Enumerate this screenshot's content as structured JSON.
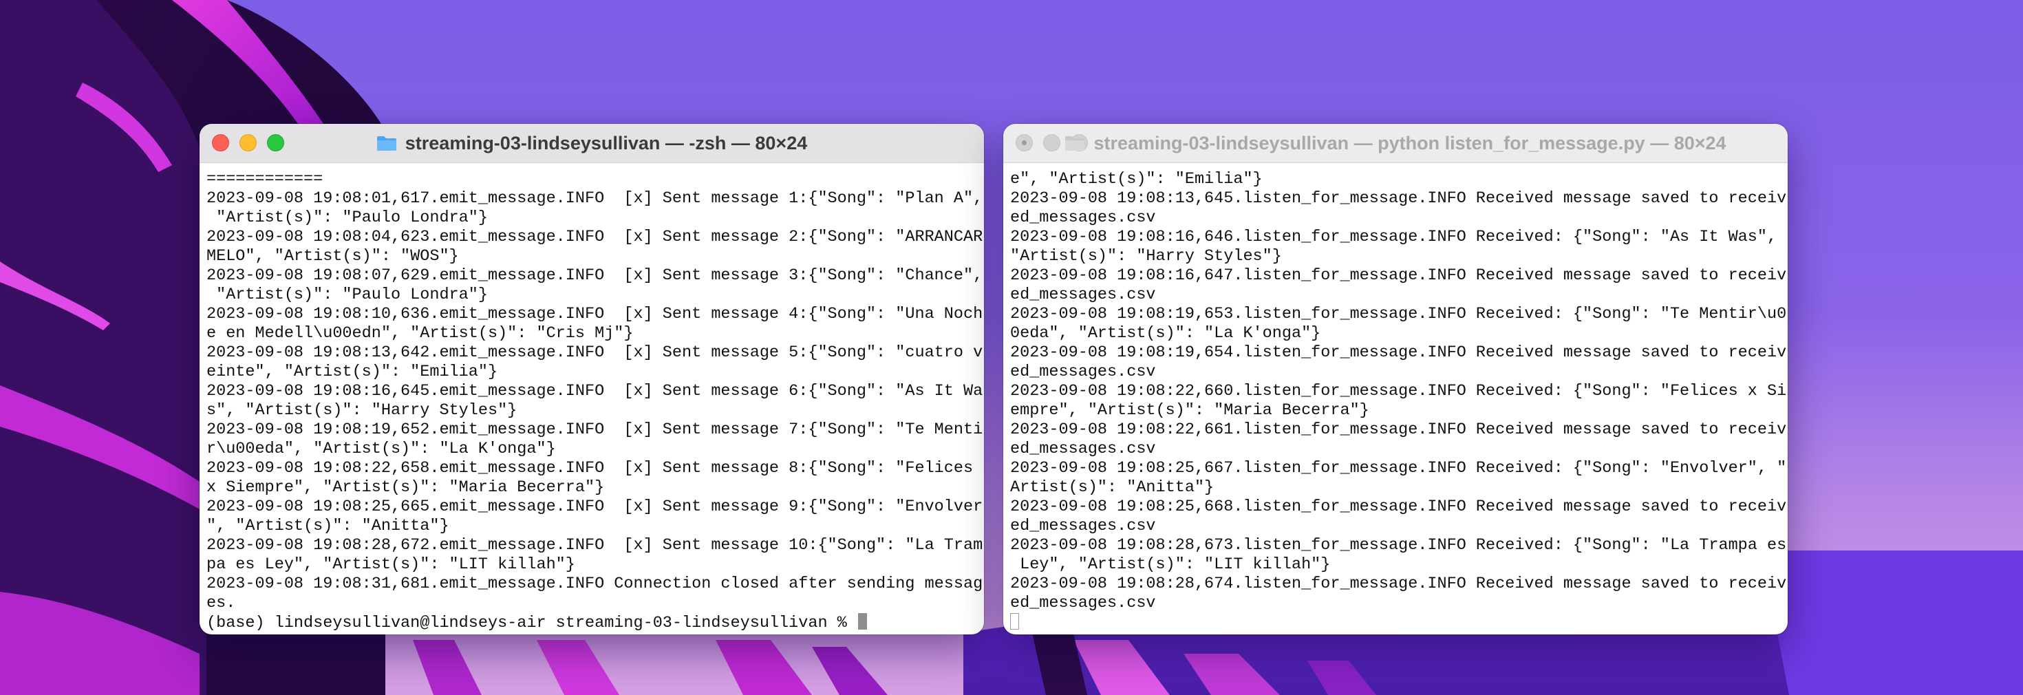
{
  "left_window": {
    "title": "streaming-03-lindseysullivan — -zsh — 80×24",
    "lines": [
      "============",
      "2023-09-08 19:08:01,617.emit_message.INFO  [x] Sent message 1:{\"Song\": \"Plan A\",",
      " \"Artist(s)\": \"Paulo Londra\"}",
      "2023-09-08 19:08:04,623.emit_message.INFO  [x] Sent message 2:{\"Song\": \"ARRANCAR",
      "MELO\", \"Artist(s)\": \"WOS\"}",
      "2023-09-08 19:08:07,629.emit_message.INFO  [x] Sent message 3:{\"Song\": \"Chance\",",
      " \"Artist(s)\": \"Paulo Londra\"}",
      "2023-09-08 19:08:10,636.emit_message.INFO  [x] Sent message 4:{\"Song\": \"Una Noch",
      "e en Medell\\u00edn\", \"Artist(s)\": \"Cris Mj\"}",
      "2023-09-08 19:08:13,642.emit_message.INFO  [x] Sent message 5:{\"Song\": \"cuatro v",
      "einte\", \"Artist(s)\": \"Emilia\"}",
      "2023-09-08 19:08:16,645.emit_message.INFO  [x] Sent message 6:{\"Song\": \"As It Wa",
      "s\", \"Artist(s)\": \"Harry Styles\"}",
      "2023-09-08 19:08:19,652.emit_message.INFO  [x] Sent message 7:{\"Song\": \"Te Menti",
      "r\\u00eda\", \"Artist(s)\": \"La K'onga\"}",
      "2023-09-08 19:08:22,658.emit_message.INFO  [x] Sent message 8:{\"Song\": \"Felices",
      "x Siempre\", \"Artist(s)\": \"Maria Becerra\"}",
      "2023-09-08 19:08:25,665.emit_message.INFO  [x] Sent message 9:{\"Song\": \"Envolver",
      "\", \"Artist(s)\": \"Anitta\"}",
      "2023-09-08 19:08:28,672.emit_message.INFO  [x] Sent message 10:{\"Song\": \"La Tram",
      "pa es Ley\", \"Artist(s)\": \"LIT killah\"}",
      "2023-09-08 19:08:31,681.emit_message.INFO Connection closed after sending messag",
      "es."
    ],
    "prompt": "(base) lindseysullivan@lindseys-air streaming-03-lindseysullivan % "
  },
  "right_window": {
    "title": "streaming-03-lindseysullivan — python listen_for_message.py — 80×24",
    "lines": [
      "e\", \"Artist(s)\": \"Emilia\"}",
      "2023-09-08 19:08:13,645.listen_for_message.INFO Received message saved to receiv",
      "ed_messages.csv",
      "2023-09-08 19:08:16,646.listen_for_message.INFO Received: {\"Song\": \"As It Was\",",
      "\"Artist(s)\": \"Harry Styles\"}",
      "2023-09-08 19:08:16,647.listen_for_message.INFO Received message saved to receiv",
      "ed_messages.csv",
      "2023-09-08 19:08:19,653.listen_for_message.INFO Received: {\"Song\": \"Te Mentir\\u0",
      "0eda\", \"Artist(s)\": \"La K'onga\"}",
      "2023-09-08 19:08:19,654.listen_for_message.INFO Received message saved to receiv",
      "ed_messages.csv",
      "2023-09-08 19:08:22,660.listen_for_message.INFO Received: {\"Song\": \"Felices x Si",
      "empre\", \"Artist(s)\": \"Maria Becerra\"}",
      "2023-09-08 19:08:22,661.listen_for_message.INFO Received message saved to receiv",
      "ed_messages.csv",
      "2023-09-08 19:08:25,667.listen_for_message.INFO Received: {\"Song\": \"Envolver\", \"",
      "Artist(s)\": \"Anitta\"}",
      "2023-09-08 19:08:25,668.listen_for_message.INFO Received message saved to receiv",
      "ed_messages.csv",
      "2023-09-08 19:08:28,673.listen_for_message.INFO Received: {\"Song\": \"La Trampa es",
      " Ley\", \"Artist(s)\": \"LIT killah\"}",
      "2023-09-08 19:08:28,674.listen_for_message.INFO Received message saved to receiv",
      "ed_messages.csv"
    ]
  },
  "colors": {
    "close": "#fe5f57",
    "minimize": "#febc2e",
    "zoom": "#28c840",
    "inactive_light": "#d1d1d1",
    "terminal_text": "#111111"
  }
}
